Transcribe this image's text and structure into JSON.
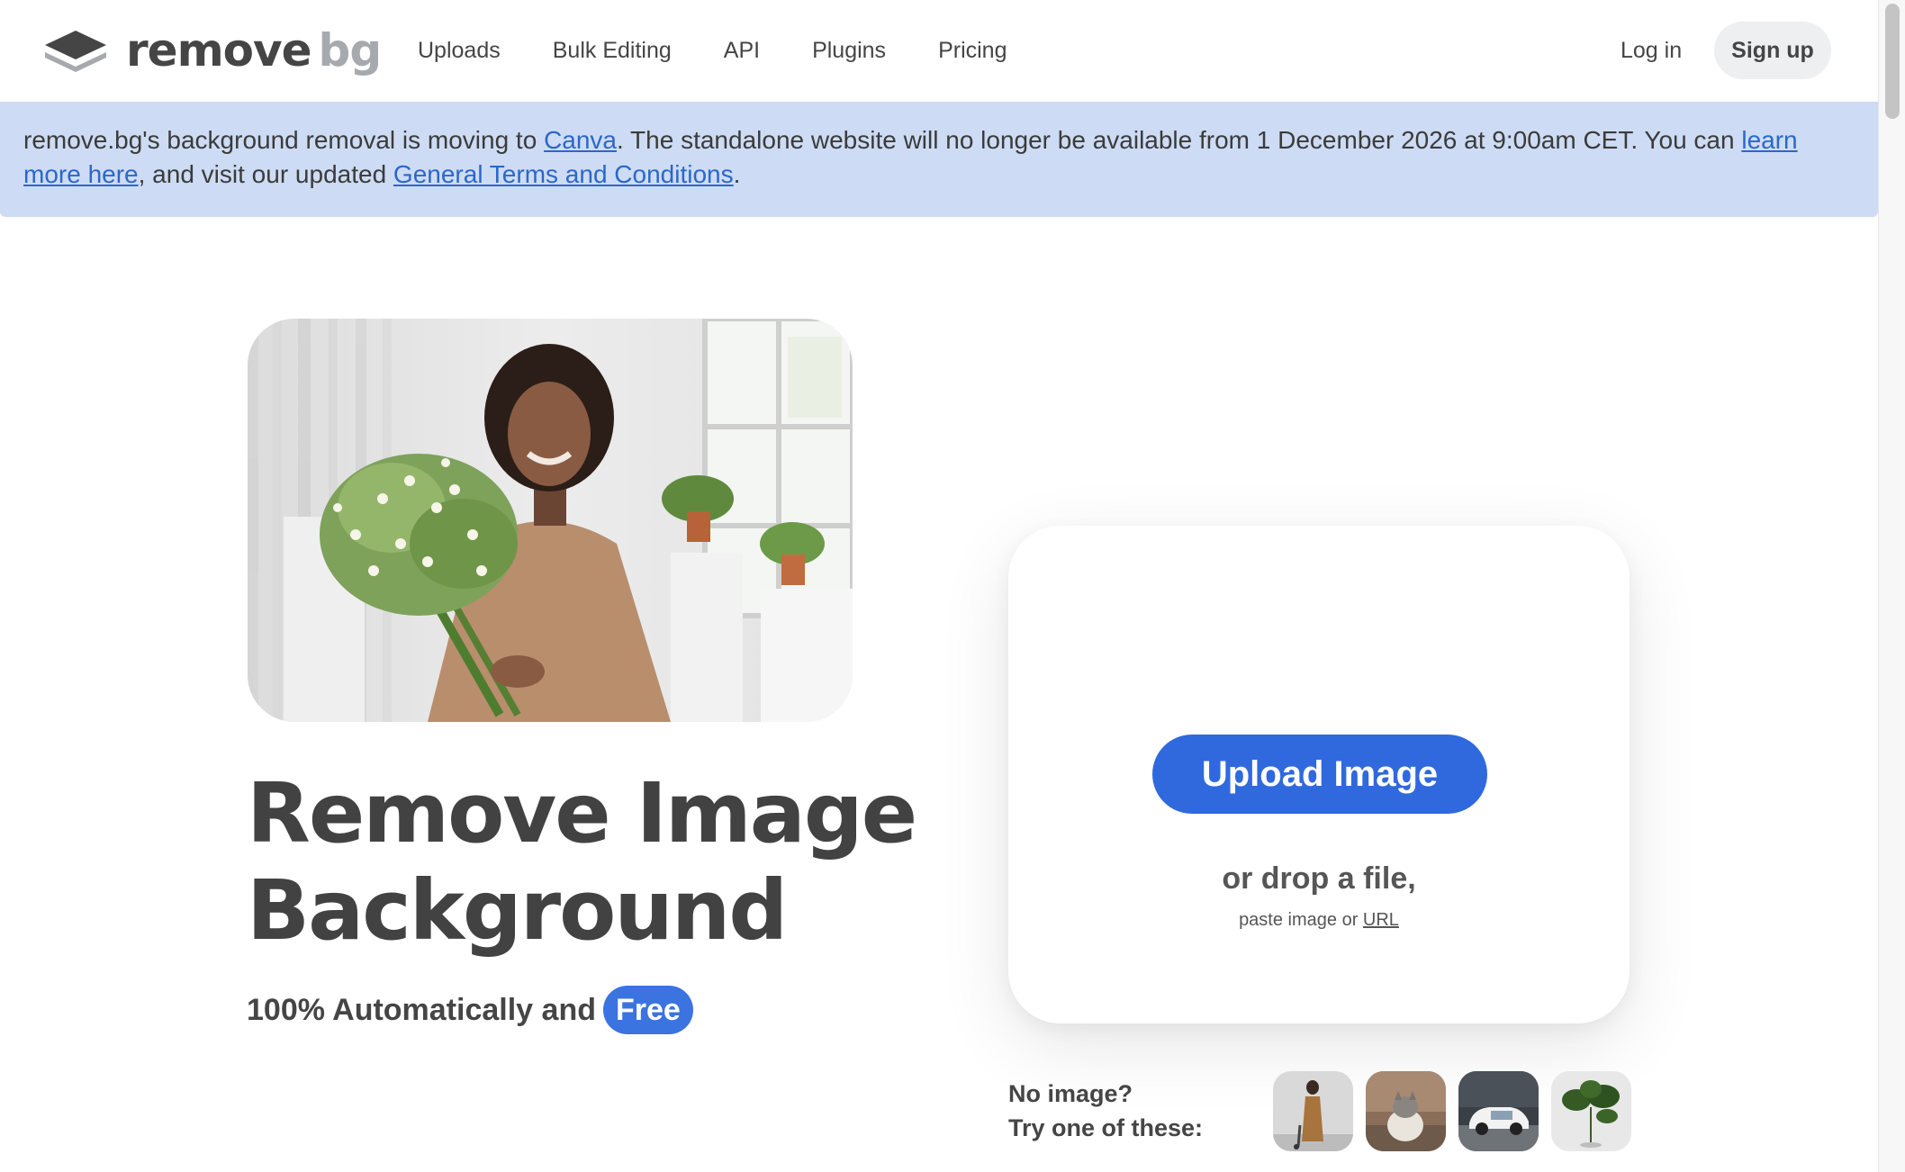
{
  "header": {
    "logo": {
      "word1": "remove",
      "word2": "bg"
    },
    "nav": [
      "Uploads",
      "Bulk Editing",
      "API",
      "Plugins",
      "Pricing"
    ],
    "login": "Log in",
    "signup": "Sign up"
  },
  "banner": {
    "t1": "remove.bg's background removal is moving to ",
    "link1": "Canva",
    "t2": ". The standalone website will no longer be available from 1 December 2026 at 9:00am CET. You can ",
    "link2": "learn more here",
    "t3": ", and visit our updated ",
    "link3": "General Terms and Conditions",
    "t4": "."
  },
  "hero": {
    "title_line1": "Remove Image",
    "title_line2": "Background",
    "subtitle": "100% Automatically and",
    "badge": "Free"
  },
  "upload": {
    "button": "Upload Image",
    "drop_text": "or drop a file,",
    "paste_text": "paste image or ",
    "url_link": "URL"
  },
  "samples": {
    "label_line1": "No image?",
    "label_line2": "Try one of these:"
  },
  "colors": {
    "primary": "#3069de",
    "banner_bg": "#cddcf4",
    "link": "#2c67c9",
    "text": "#454545"
  }
}
